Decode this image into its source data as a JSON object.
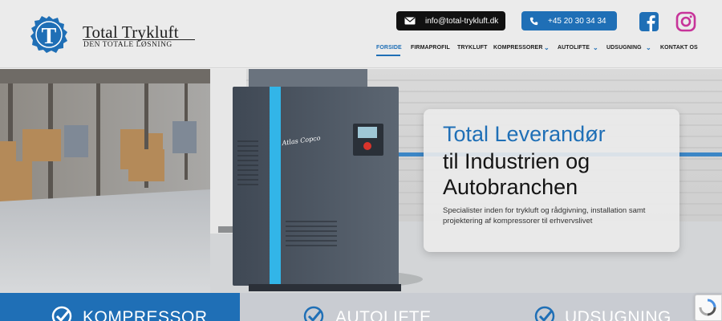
{
  "brand": {
    "name": "Total Trykluft",
    "tagline": "DEN TOTALE LØSNING",
    "logo_letter": "T"
  },
  "contact": {
    "email": "info@total-trykluft.dk",
    "phone": "+45 20 30 34 34"
  },
  "social": [
    {
      "name": "facebook-icon"
    },
    {
      "name": "instagram-icon"
    }
  ],
  "nav": {
    "items": [
      {
        "label": "FORSIDE",
        "active": true
      },
      {
        "label": "FIRMAPROFIL"
      },
      {
        "label": "TRYKLUFT"
      },
      {
        "label": "KOMPRESSORER",
        "dropdown": true
      },
      {
        "label": "AUTOLIFTE",
        "dropdown": true
      },
      {
        "label": "UDSUGNING",
        "dropdown": true
      },
      {
        "label": "KONTAKT OS"
      }
    ]
  },
  "hero": {
    "headline_line1": "Total Leverandør",
    "headline_line2": "til Industrien og",
    "headline_line3": "Autobranchen",
    "description": "Specialister inden for trykluft og rådgivning, installation samt projektering af kompressorer til erhvervslivet",
    "machine_brand": "Atlas Copco"
  },
  "feature_boxes": [
    {
      "label": "KOMPRESSOR"
    },
    {
      "label": "AUTOLIFTE"
    },
    {
      "label": "UDSUGNING"
    }
  ],
  "colors": {
    "primary": "#1f6fb6",
    "dark": "#111111",
    "header_bg": "#ebebeb",
    "box_inactive": "#c9ccd2"
  }
}
